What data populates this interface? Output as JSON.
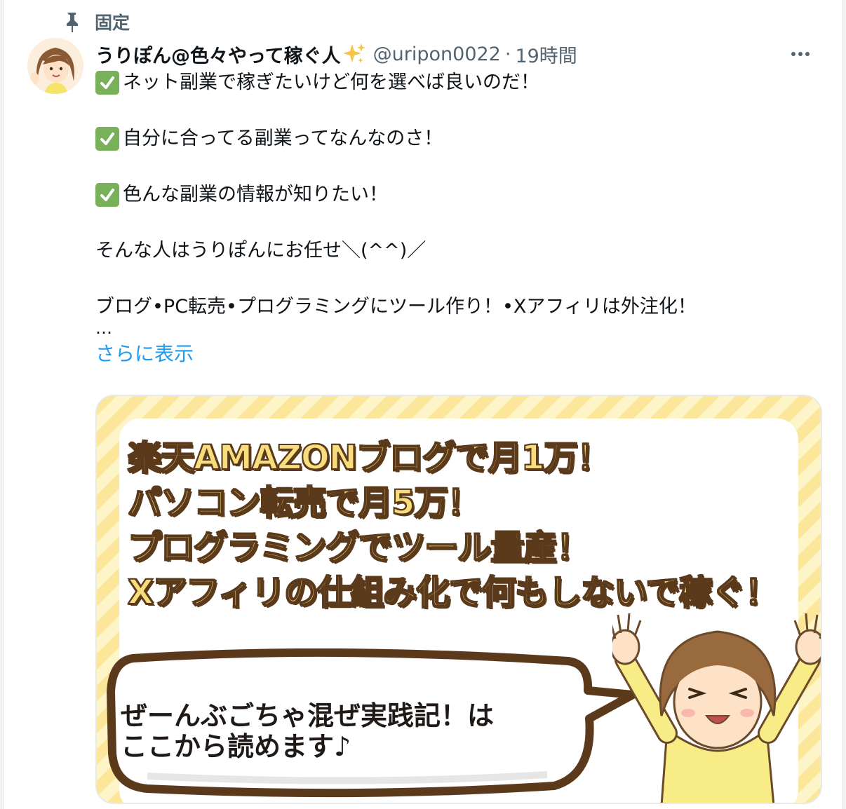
{
  "pinned": {
    "label": "固定"
  },
  "tweet": {
    "display_name": "うりぽん@色々やって稼ぐ人",
    "handle": "@uripon0022",
    "separator": "·",
    "time": "19時間",
    "lines": {
      "l1": "ネット副業で稼ぎたいけど何を選べば良いのだ！",
      "l2": "自分に合ってる副業ってなんなのさ！",
      "l3": "色んな副業の情報が知りたい！",
      "l4": "そんな人はうりぽんにお任せ＼(^^)／",
      "l5": "ブログ•PC転売•プログラミングにツール作り！•Xアフィリは外注化！",
      "l6": "…"
    },
    "show_more": "さらに表示"
  },
  "media": {
    "promo": {
      "p1": "楽天AMAZONブログで月1万！",
      "p2": "パソコン転売で月5万！",
      "p3": "プログラミングでツール量産！",
      "p4": "Xアフィリの仕組み化で何もしないで稼ぐ！"
    },
    "bubble": {
      "b1": "ぜーんぶごちゃ混ぜ実践記！は",
      "b2": "ここから読めます♪"
    }
  },
  "colors": {
    "handle_gray": "#536471",
    "link_blue": "#1d9bf0",
    "check_green": "#78b159",
    "stripe_yellow": "#fbe69a",
    "promo_text": "#f7dd7c",
    "promo_outline": "#5b3a1c"
  },
  "icons": [
    "pin-icon",
    "sparkle-icon",
    "check-icon",
    "more-icon"
  ]
}
